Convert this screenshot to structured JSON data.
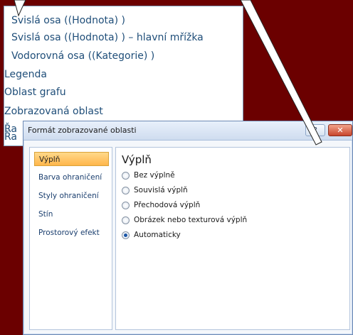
{
  "menu": {
    "items": [
      "Svislá  osa ((Hodnota) )",
      "Svislá  osa ((Hodnota) )  – hlavní mřížka",
      "Vodorovná  osa ((Kategorie) )",
      "Legenda",
      "Oblast grafu",
      "Zobrazovaná oblast",
      "Řa",
      "Řa"
    ]
  },
  "dialog": {
    "title": "Formát zobrazované oblasti",
    "help_label": "?",
    "close_label": "✕",
    "nav": [
      "Výplň",
      "Barva ohraničení",
      "Styly ohraničení",
      "Stín",
      "Prostorový efekt"
    ],
    "section_title": "Výplň",
    "options": [
      {
        "label": "Bez výplně",
        "checked": false
      },
      {
        "label": "Souvislá výplň",
        "checked": false
      },
      {
        "label": "Přechodová výplň",
        "checked": false
      },
      {
        "label": "Obrázek nebo texturová výplň",
        "checked": false
      },
      {
        "label": "Automaticky",
        "checked": true
      }
    ]
  },
  "colors": {
    "background": "#6b0000",
    "menu_text": "#1f4e79",
    "nav_selected": "#ffb64b",
    "radio_checked": "#1b56a6"
  }
}
